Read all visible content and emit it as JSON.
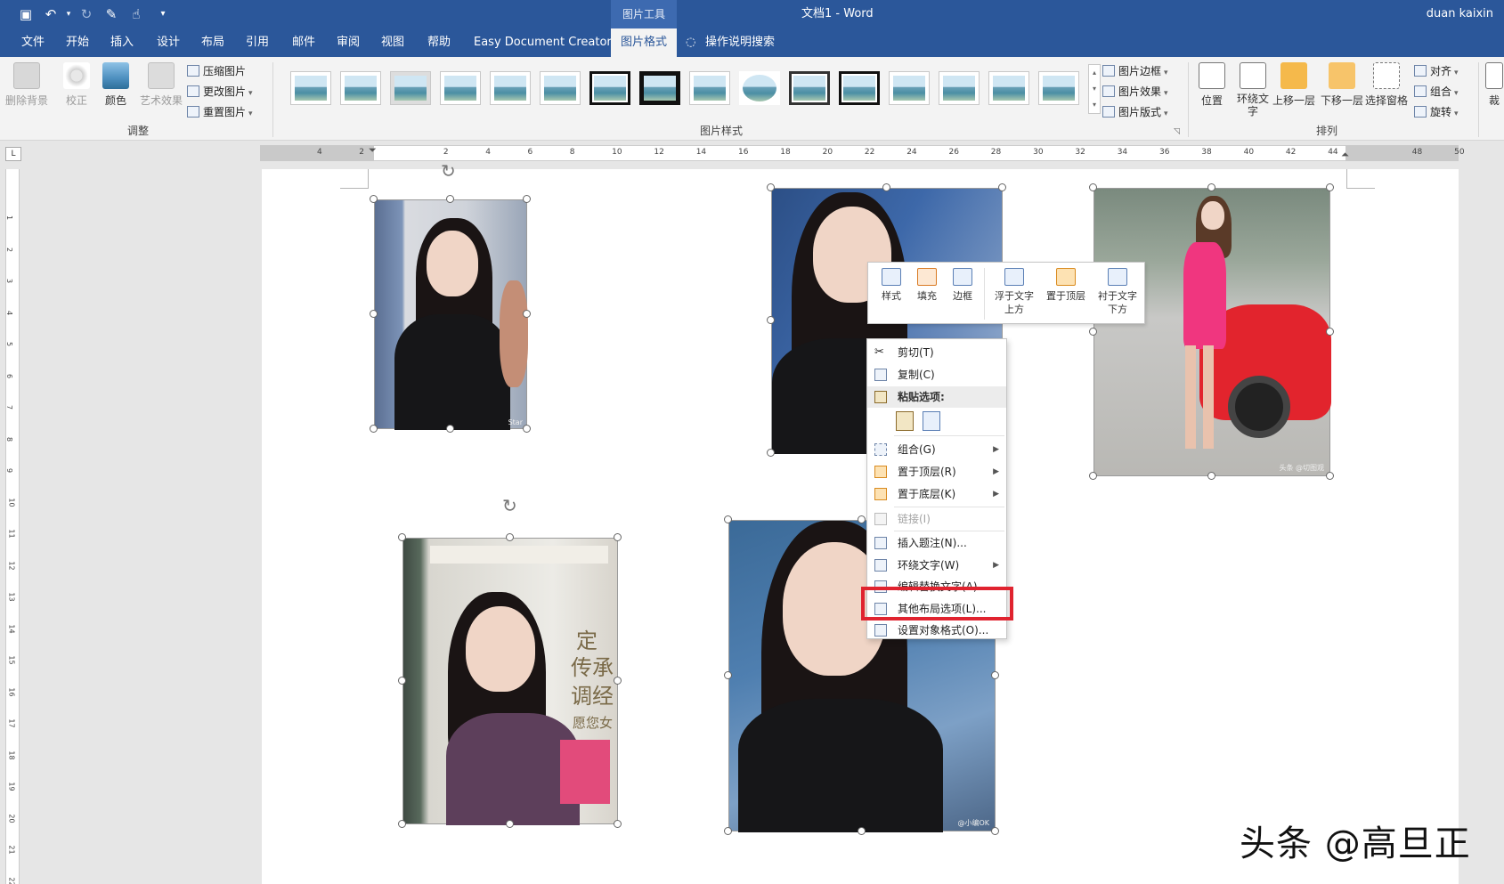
{
  "titlebar": {
    "contextual_group": "图片工具",
    "document_title": "文档1  -  Word",
    "user": "duan kaixin"
  },
  "tabs": [
    {
      "label": "文件"
    },
    {
      "label": "开始"
    },
    {
      "label": "插入"
    },
    {
      "label": "设计"
    },
    {
      "label": "布局"
    },
    {
      "label": "引用"
    },
    {
      "label": "邮件"
    },
    {
      "label": "审阅"
    },
    {
      "label": "视图"
    },
    {
      "label": "帮助"
    },
    {
      "label": "Easy Document Creator"
    },
    {
      "label": "图片格式"
    }
  ],
  "active_tab": "图片格式",
  "search": {
    "label": "操作说明搜索"
  },
  "ribbon": {
    "adjust": {
      "remove_bg": "删除背景",
      "corrections": "校正",
      "color": "颜色",
      "artistic": "艺术效果",
      "compress": "压缩图片",
      "change": "更改图片",
      "reset": "重置图片",
      "group_label": "调整"
    },
    "styles": {
      "border": "图片边框",
      "effects": "图片效果",
      "layout": "图片版式",
      "group_label": "图片样式"
    },
    "arrange": {
      "position": "位置",
      "wrap_line1": "环绕文",
      "wrap_line2": "字",
      "forward": "上移一层",
      "backward": "下移一层",
      "pane": "选择窗格",
      "align": "对齐",
      "group": "组合",
      "rotate": "旋转",
      "group_label": "排列"
    },
    "size_partial": "裁"
  },
  "ruler": {
    "h_labels": [
      "4",
      "2",
      "",
      "2",
      "4",
      "6",
      "8",
      "10",
      "12",
      "14",
      "16",
      "18",
      "20",
      "22",
      "24",
      "26",
      "28",
      "30",
      "32",
      "34",
      "36",
      "38",
      "40",
      "42",
      "44",
      "",
      "48",
      "50"
    ],
    "v_labels": [
      "1",
      "2",
      "3",
      "4",
      "5",
      "6",
      "7",
      "8",
      "9",
      "10",
      "11",
      "12",
      "13",
      "14",
      "15",
      "16",
      "17",
      "18",
      "19",
      "20",
      "21",
      "22"
    ]
  },
  "minibar": {
    "style": "样式",
    "fill": "填充",
    "border": "边框",
    "in_front_l1": "浮于文字",
    "in_front_l2": "上方",
    "bring_front": "置于顶层",
    "behind_l1": "衬于文字",
    "behind_l2": "下方"
  },
  "context_menu": {
    "cut": "剪切(T)",
    "copy": "复制(C)",
    "paste_options": "粘贴选项:",
    "group": "组合(G)",
    "bring_front": "置于顶层(R)",
    "send_back": "置于底层(K)",
    "link": "链接(I)",
    "insert_caption": "插入题注(N)...",
    "wrap_text": "环绕文字(W)",
    "edit_alt": "编辑替换文字(A)...",
    "more_layout": "其他布局选项(L)...",
    "format_object": "设置对象格式(O)..."
  },
  "photo_text": {
    "poster_line1": "传承",
    "poster_line2": "调经",
    "poster_line3": "愿您女",
    "poster_side": "定",
    "wm1": "头条 @切图观",
    "wm2": "@小编OK",
    "wm3": "Star"
  },
  "watermark": "头条 @高旦正",
  "colors": {
    "word_blue": "#2b579a",
    "highlight_red": "#e0232f"
  }
}
